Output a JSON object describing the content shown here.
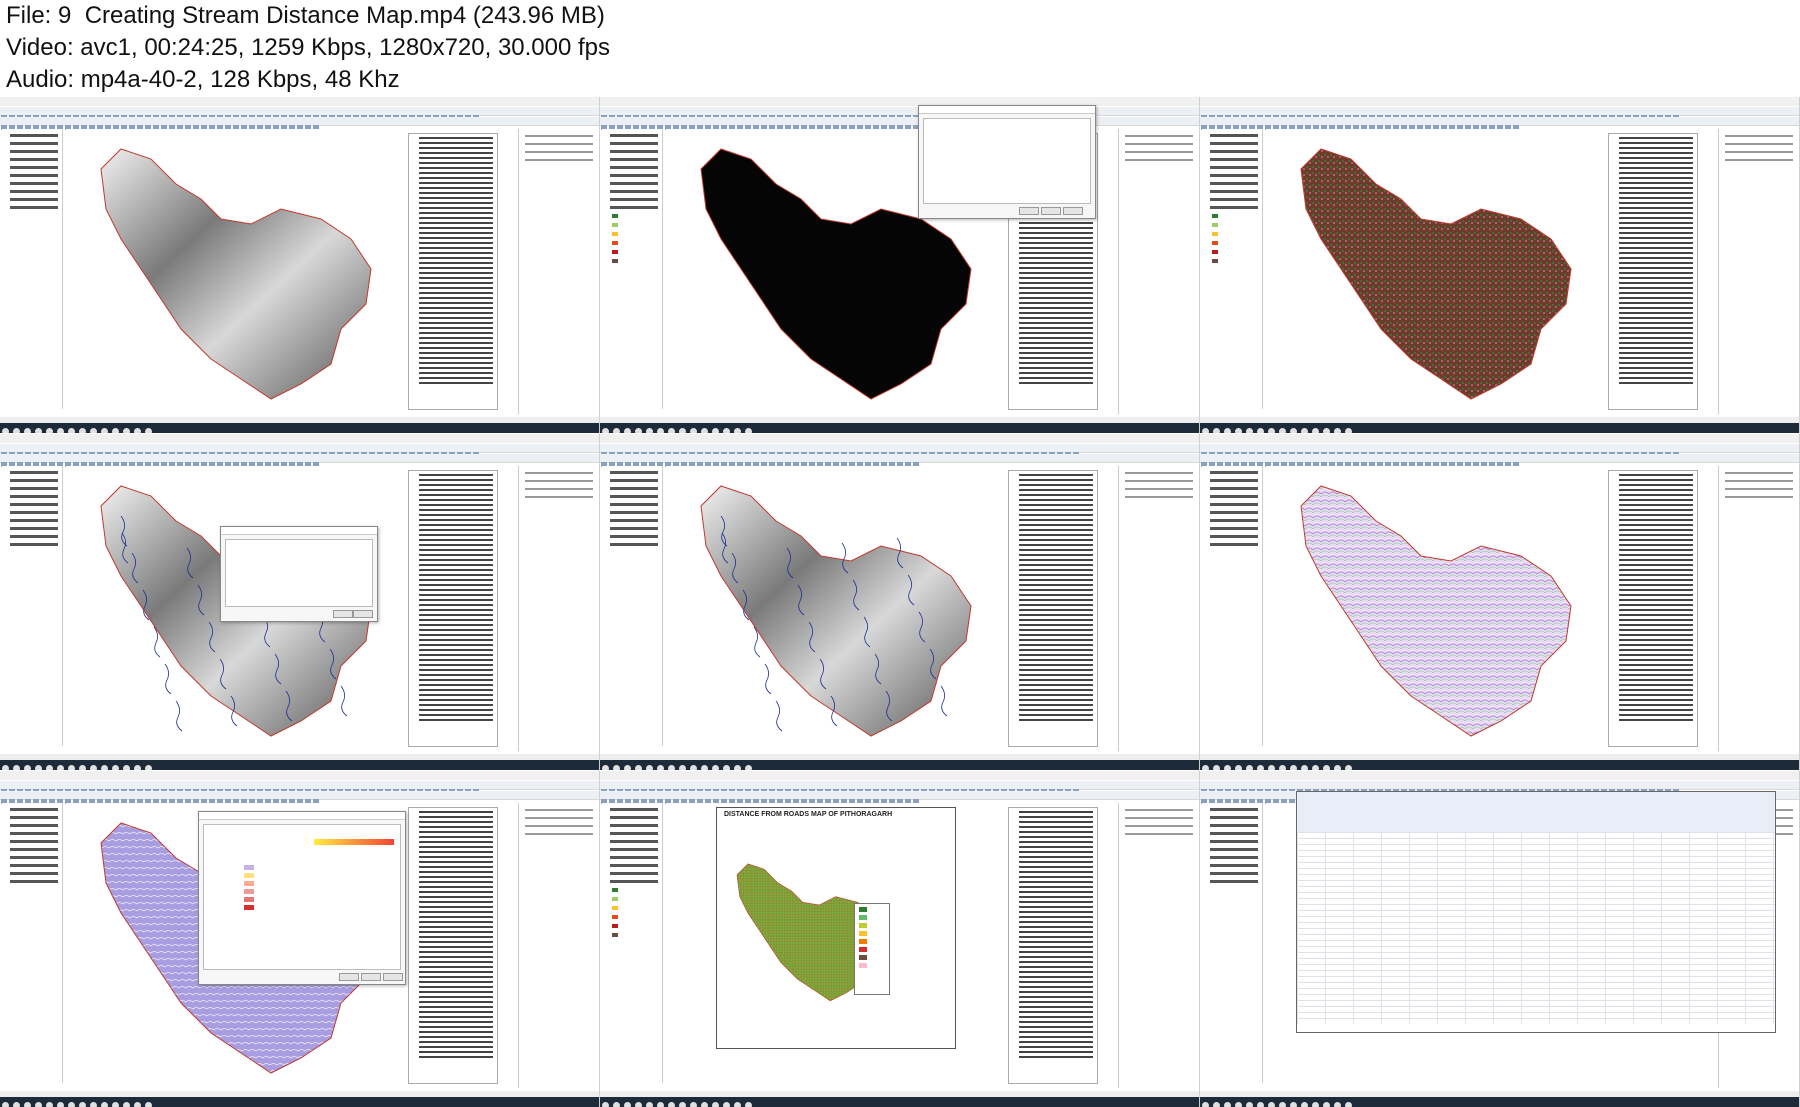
{
  "header": {
    "file_line": "File: 9  Creating Stream Distance Map.mp4 (243.96 MB)",
    "video_line": "Video: avc1, 00:24:25, 1259 Kbps, 1280x720, 30.000 fps",
    "audio_line": "Audio: mp4a-40-2, 128 Kbps, 48 Khz"
  },
  "thumbnails": [
    {
      "id": "t1",
      "scene": "grayscale-dem"
    },
    {
      "id": "t2",
      "scene": "black-raster-with-dialog"
    },
    {
      "id": "t3",
      "scene": "flow-direction-raster"
    },
    {
      "id": "t4",
      "scene": "dem-streams-with-save-dialog"
    },
    {
      "id": "t5",
      "scene": "dem-with-streams"
    },
    {
      "id": "t6",
      "scene": "euclidean-distance-contours"
    },
    {
      "id": "t7",
      "scene": "layer-properties-symbology"
    },
    {
      "id": "t8",
      "scene": "layout-map"
    },
    {
      "id": "t9",
      "scene": "excel-criteria-sheet"
    }
  ],
  "layout_map": {
    "title": "DISTANCE FROM ROADS  MAP OF PITHORAGARH"
  },
  "colors": {
    "taskbar": "#1c2a3a",
    "boundary": "#c0392b",
    "streams": "#1f2f8f",
    "flowdir": "#7a3a2a",
    "distance": "#c9a0e6",
    "symbology": "#8f86d6",
    "map_green": "#7aa83a"
  }
}
